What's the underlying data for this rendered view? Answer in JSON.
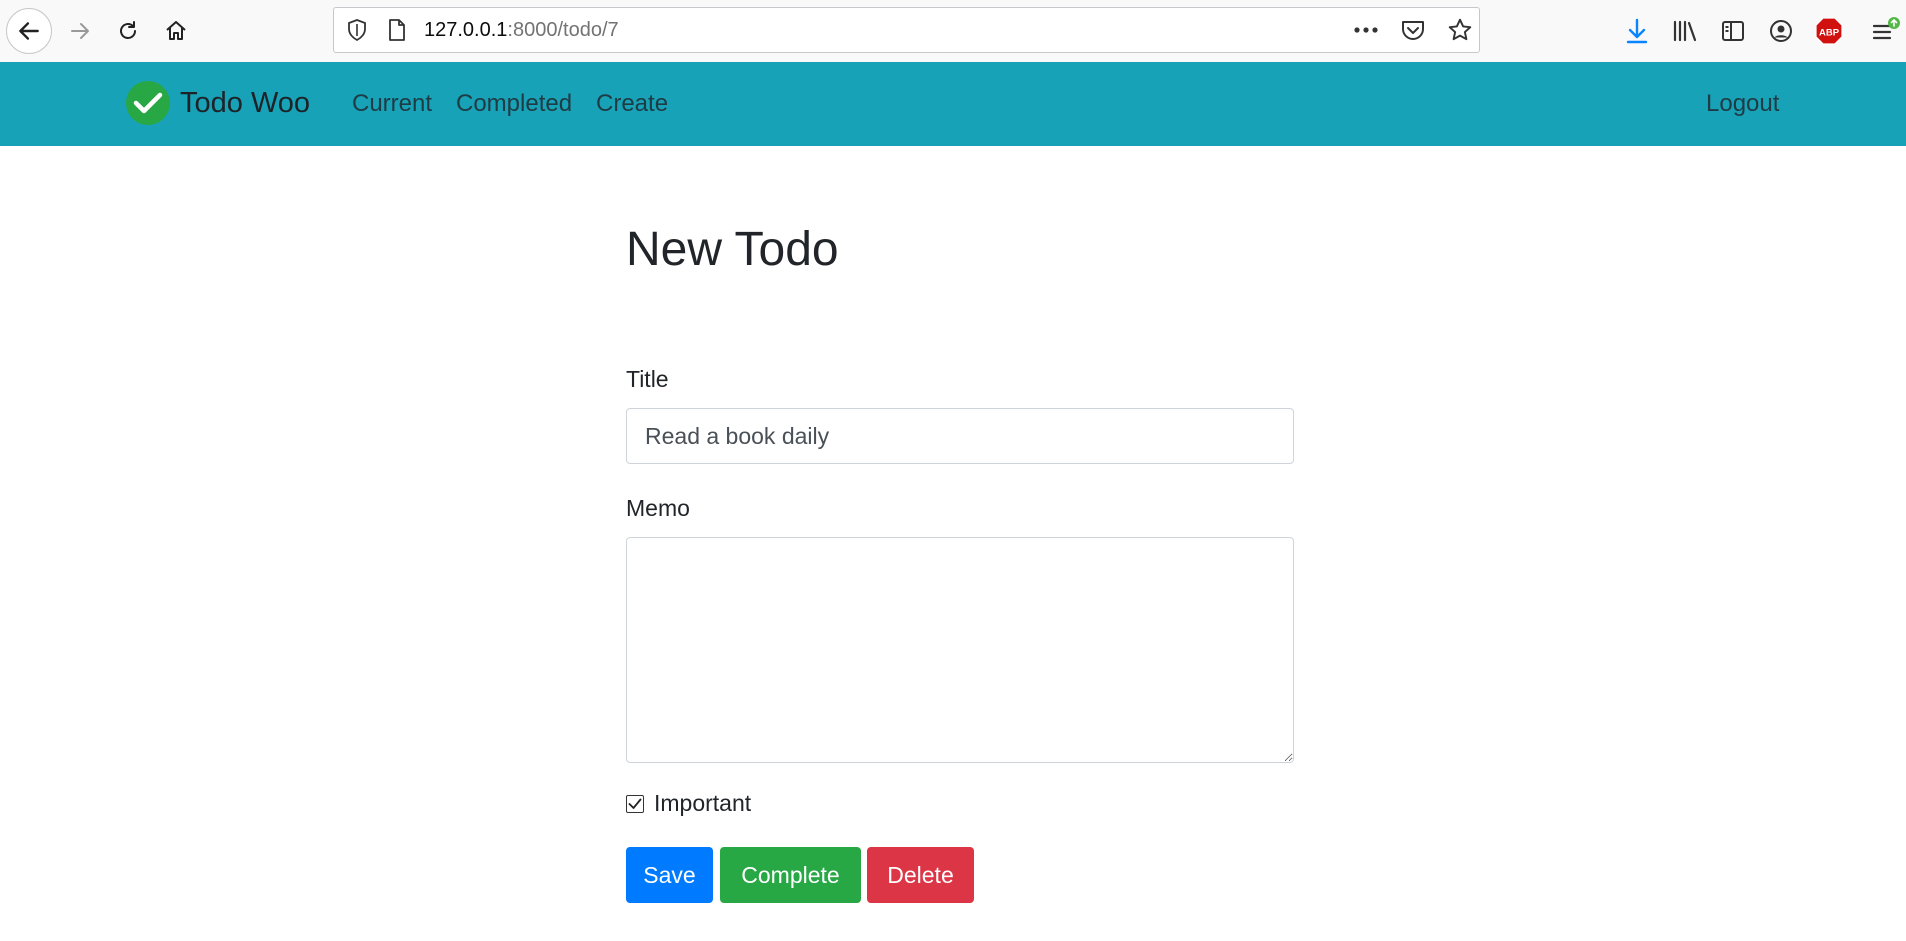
{
  "browser": {
    "url_host": "127.0.0.1",
    "url_rest": ":8000/todo/7",
    "icons": [
      "back-arrow-icon",
      "forward-arrow-icon",
      "reload-icon",
      "home-icon",
      "shield-icon",
      "page-icon",
      "more-dots-icon",
      "pocket-icon",
      "star-icon",
      "download-icon",
      "library-icon",
      "sidebar-icon",
      "account-icon",
      "adblock-icon",
      "menu-icon"
    ],
    "adblock_label": "ABP"
  },
  "navbar": {
    "brand": "Todo Woo",
    "links": {
      "current": "Current",
      "completed": "Completed",
      "create": "Create"
    },
    "logout": "Logout",
    "colors": {
      "bar": "#17a2b8",
      "logo": "#28a745"
    }
  },
  "page": {
    "title": "New Todo",
    "form": {
      "title_label": "Title",
      "title_value": "Read a book daily",
      "memo_label": "Memo",
      "memo_value": "",
      "important_label": "Important",
      "important_checked": true
    },
    "buttons": {
      "save": "Save",
      "complete": "Complete",
      "delete": "Delete"
    },
    "colors": {
      "save": "#007bff",
      "complete": "#28a745",
      "delete": "#dc3545"
    }
  }
}
